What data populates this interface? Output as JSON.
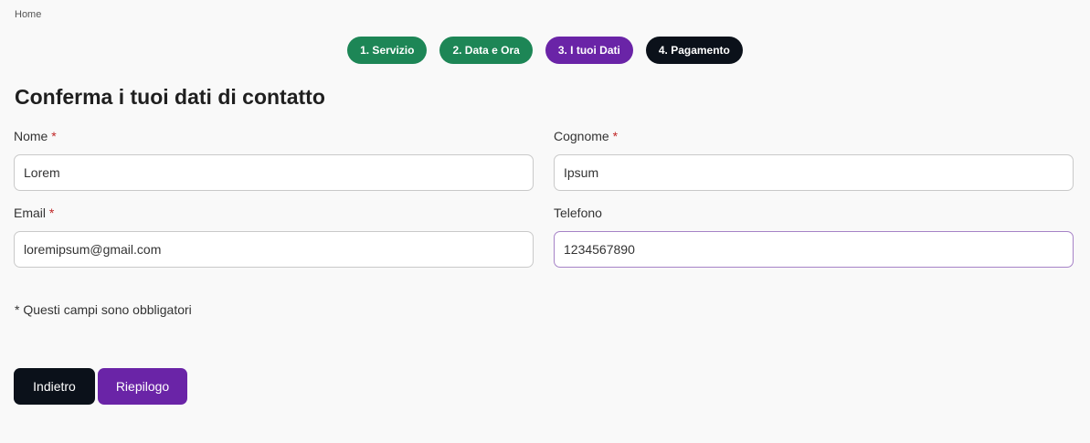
{
  "breadcrumb": {
    "home": "Home"
  },
  "steps": [
    {
      "label": "1. Servizio",
      "state": "done"
    },
    {
      "label": "2. Data e Ora",
      "state": "done"
    },
    {
      "label": "3. I tuoi Dati",
      "state": "active"
    },
    {
      "label": "4. Pagamento",
      "state": "todo"
    }
  ],
  "title": "Conferma i tuoi dati di contatto",
  "form": {
    "nome": {
      "label": "Nome",
      "required_mark": "*",
      "value": "Lorem"
    },
    "cognome": {
      "label": "Cognome",
      "required_mark": "*",
      "value": "Ipsum"
    },
    "email": {
      "label": "Email",
      "required_mark": "*",
      "value": "loremipsum@gmail.com"
    },
    "telefono": {
      "label": "Telefono",
      "value": "1234567890"
    }
  },
  "note": "* Questi campi sono obbligatori",
  "buttons": {
    "back": "Indietro",
    "next": "Riepilogo"
  },
  "colors": {
    "step_done": "#1d8656",
    "step_active": "#6a24a7",
    "step_todo": "#0b111a",
    "required": "#c02626",
    "background": "#f9f9f9"
  }
}
